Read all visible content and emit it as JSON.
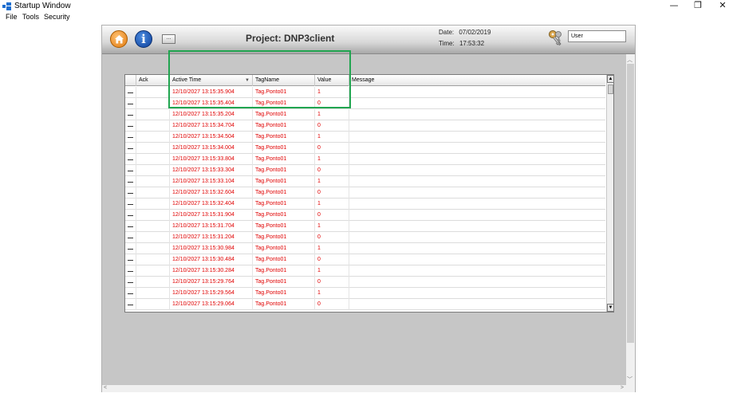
{
  "window": {
    "title": "Startup Window",
    "minimize": "—",
    "restore": "❐",
    "close": "✕"
  },
  "menu": [
    "File",
    "Tools",
    "Security"
  ],
  "header": {
    "more_label": "...",
    "project_title": "Project: DNP3client",
    "date_label": "Date:",
    "date_value": "07/02/2019",
    "time_label": "Time:",
    "time_value": "17:53:32",
    "user_value": "User",
    "icons": [
      "home-icon",
      "info-icon",
      "keys-icon"
    ]
  },
  "alarm_grid": {
    "columns": [
      "Ack",
      "Active Time",
      "TagName",
      "Value",
      "Message"
    ],
    "rows": [
      {
        "ack": "",
        "time": "12/10/2027 13:15:35.904",
        "tag": "Tag.Ponto01",
        "value": "1",
        "message": ""
      },
      {
        "ack": "",
        "time": "12/10/2027 13:15:35.404",
        "tag": "Tag.Ponto01",
        "value": "0",
        "message": ""
      },
      {
        "ack": "",
        "time": "12/10/2027 13:15:35.204",
        "tag": "Tag.Ponto01",
        "value": "1",
        "message": ""
      },
      {
        "ack": "",
        "time": "12/10/2027 13:15:34.704",
        "tag": "Tag.Ponto01",
        "value": "0",
        "message": ""
      },
      {
        "ack": "",
        "time": "12/10/2027 13:15:34.504",
        "tag": "Tag.Ponto01",
        "value": "1",
        "message": ""
      },
      {
        "ack": "",
        "time": "12/10/2027 13:15:34.004",
        "tag": "Tag.Ponto01",
        "value": "0",
        "message": ""
      },
      {
        "ack": "",
        "time": "12/10/2027 13:15:33.804",
        "tag": "Tag.Ponto01",
        "value": "1",
        "message": ""
      },
      {
        "ack": "",
        "time": "12/10/2027 13:15:33.304",
        "tag": "Tag.Ponto01",
        "value": "0",
        "message": ""
      },
      {
        "ack": "",
        "time": "12/10/2027 13:15:33.104",
        "tag": "Tag.Ponto01",
        "value": "1",
        "message": ""
      },
      {
        "ack": "",
        "time": "12/10/2027 13:15:32.604",
        "tag": "Tag.Ponto01",
        "value": "0",
        "message": ""
      },
      {
        "ack": "",
        "time": "12/10/2027 13:15:32.404",
        "tag": "Tag.Ponto01",
        "value": "1",
        "message": ""
      },
      {
        "ack": "",
        "time": "12/10/2027 13:15:31.904",
        "tag": "Tag.Ponto01",
        "value": "0",
        "message": ""
      },
      {
        "ack": "",
        "time": "12/10/2027 13:15:31.704",
        "tag": "Tag.Ponto01",
        "value": "1",
        "message": ""
      },
      {
        "ack": "",
        "time": "12/10/2027 13:15:31.204",
        "tag": "Tag.Ponto01",
        "value": "0",
        "message": ""
      },
      {
        "ack": "",
        "time": "12/10/2027 13:15:30.984",
        "tag": "Tag.Ponto01",
        "value": "1",
        "message": ""
      },
      {
        "ack": "",
        "time": "12/10/2027 13:15:30.484",
        "tag": "Tag.Ponto01",
        "value": "0",
        "message": ""
      },
      {
        "ack": "",
        "time": "12/10/2027 13:15:30.284",
        "tag": "Tag.Ponto01",
        "value": "1",
        "message": ""
      },
      {
        "ack": "",
        "time": "12/10/2027 13:15:29.764",
        "tag": "Tag.Ponto01",
        "value": "0",
        "message": ""
      },
      {
        "ack": "",
        "time": "12/10/2027 13:15:29.564",
        "tag": "Tag.Ponto01",
        "value": "1",
        "message": ""
      },
      {
        "ack": "",
        "time": "12/10/2027 13:15:29.064",
        "tag": "Tag.Ponto01",
        "value": "0",
        "message": ""
      }
    ]
  },
  "colors": {
    "alarm_text": "#e00000",
    "highlight_border": "#21a550",
    "workspace_bg": "#c6c6c6"
  }
}
